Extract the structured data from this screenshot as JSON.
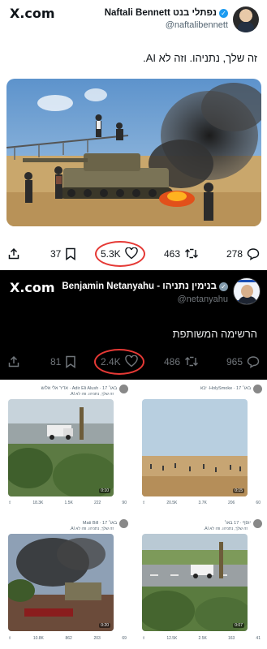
{
  "post1": {
    "logo": "X.com",
    "author_name": "נפתלי בנט Naftali Bennett",
    "handle": "@naftalibennett",
    "text": "זה שלך, נתניהו. וזה לא AI.",
    "replies": "278",
    "reposts": "463",
    "likes": "5.3K",
    "bookmarks": "37"
  },
  "post2": {
    "logo": "X.com",
    "author_name": "Benjamin Netanyahu - בנימין נתניהו",
    "handle": "@netanyahu",
    "text": "הרשימה המשותפת",
    "replies": "965",
    "reposts": "486",
    "likes": "2.4K",
    "bookmarks": "81"
  },
  "grid": [
    {
      "header": "אדיר אלי אלוש · Adir Eli Alush · 17 באו׳",
      "text": "זה שלך, נתניהו. וזה לא AI.",
      "duration": "0:10",
      "stats": [
        "18.3K",
        "1.5K",
        "222",
        "90"
      ]
    },
    {
      "header": "יבא ·HolySmoke · 17 באו׳",
      "text": "",
      "duration": "0:15",
      "stats": [
        "20.5K",
        "3.7K",
        "206",
        "60"
      ]
    },
    {
      "header": "Mati Bill · 17 באו׳",
      "text": "זה שלך, נתניהו. וזה לא AI.",
      "duration": "0:20",
      "stats": [
        "10.8K",
        "862",
        "203",
        "69"
      ]
    },
    {
      "header": "יוסף · 17 באו׳",
      "text": "זה שלך, נתניהו. וזה לא AI.",
      "duration": "0:07",
      "stats": [
        "12.5K",
        "2.5K",
        "163",
        "41"
      ]
    }
  ],
  "colors": {
    "highlight_circle": "#e53935",
    "verified": "#1d9bf0",
    "dark_bg": "#000000"
  }
}
